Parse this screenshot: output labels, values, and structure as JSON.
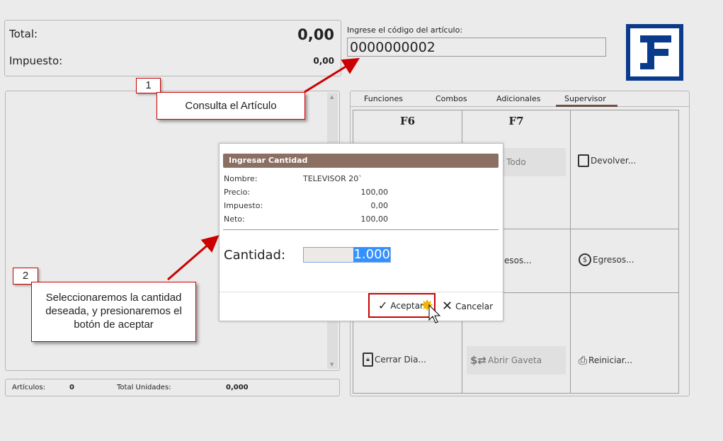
{
  "totals": {
    "total_label": "Total:",
    "total_value": "0,00",
    "tax_label": "Impuesto:",
    "tax_value": "0,00"
  },
  "code": {
    "label": "Ingrese el código del artículo:",
    "value": "0000000002"
  },
  "footer": {
    "articles_label": "Artículos:",
    "articles_value": "0",
    "units_label": "Total Unidades:",
    "units_value": "0,000"
  },
  "tabs": [
    {
      "label": "Funciones"
    },
    {
      "label": "Combos"
    },
    {
      "label": "Adicionales"
    },
    {
      "label": "Supervisor",
      "active": true
    }
  ],
  "grid": {
    "f6": "F6",
    "f7": "F7",
    "anular": "ar Todo",
    "devolver": "Devolver...",
    "ingresos": "esos...",
    "egresos": "Egresos...",
    "cerrar": "Cerrar Dia...",
    "gaveta": "Abrir Gaveta",
    "reiniciar": "Reiniciar..."
  },
  "dialog": {
    "title": "Ingresar Cantidad",
    "rows": [
      {
        "label": "Nombre:",
        "value": "TELEVISOR 20`"
      },
      {
        "label": "Precio:",
        "value": "100,00"
      },
      {
        "label": "Impuesto:",
        "value": "0,00"
      },
      {
        "label": "Neto:",
        "value": "100,00"
      }
    ],
    "qty_label": "Cantidad:",
    "qty_value": "1.000",
    "accept": "Aceptar",
    "cancel": "Cancelar"
  },
  "callouts": [
    {
      "num": "1",
      "text": "Consulta el Artículo"
    },
    {
      "num": "2",
      "text": "Seleccionaremos la cantidad deseada, y presionaremos el botón de aceptar"
    }
  ],
  "colors": {
    "dialog_header": "#8b6f63",
    "logo": "#0a3a8c",
    "callout_border": "#cc0000"
  }
}
